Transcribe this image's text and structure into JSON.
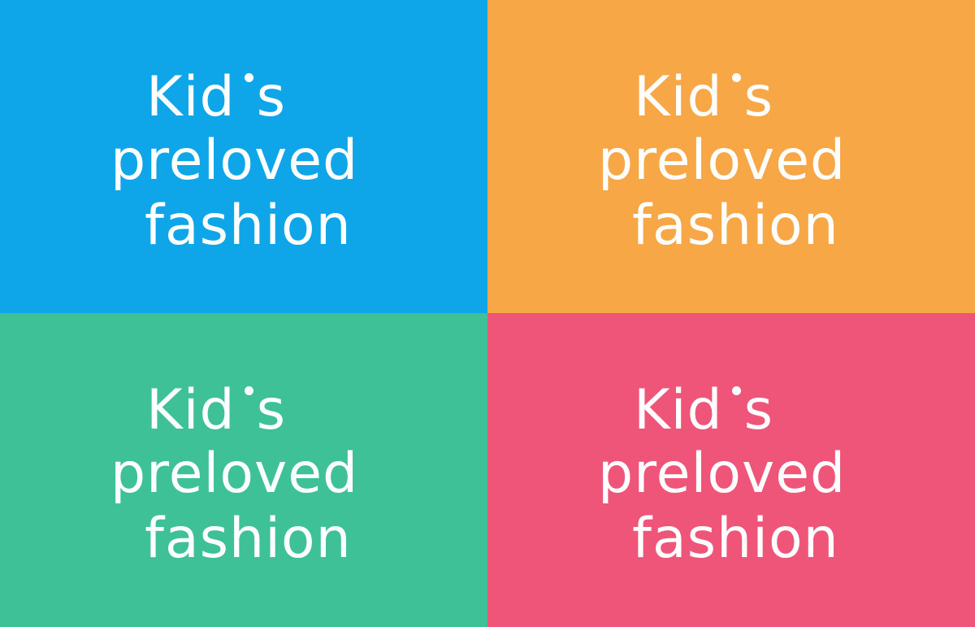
{
  "logo": {
    "line1_word": "Kid",
    "line1_suffix": "s",
    "line2": "preloved",
    "line3": "fashion",
    "text_color": "#ffffff"
  },
  "panels": [
    {
      "name": "blue",
      "color": "#0ea5e9"
    },
    {
      "name": "orange",
      "color": "#f7a745"
    },
    {
      "name": "green",
      "color": "#3ec196"
    },
    {
      "name": "pink",
      "color": "#ef5479"
    }
  ]
}
